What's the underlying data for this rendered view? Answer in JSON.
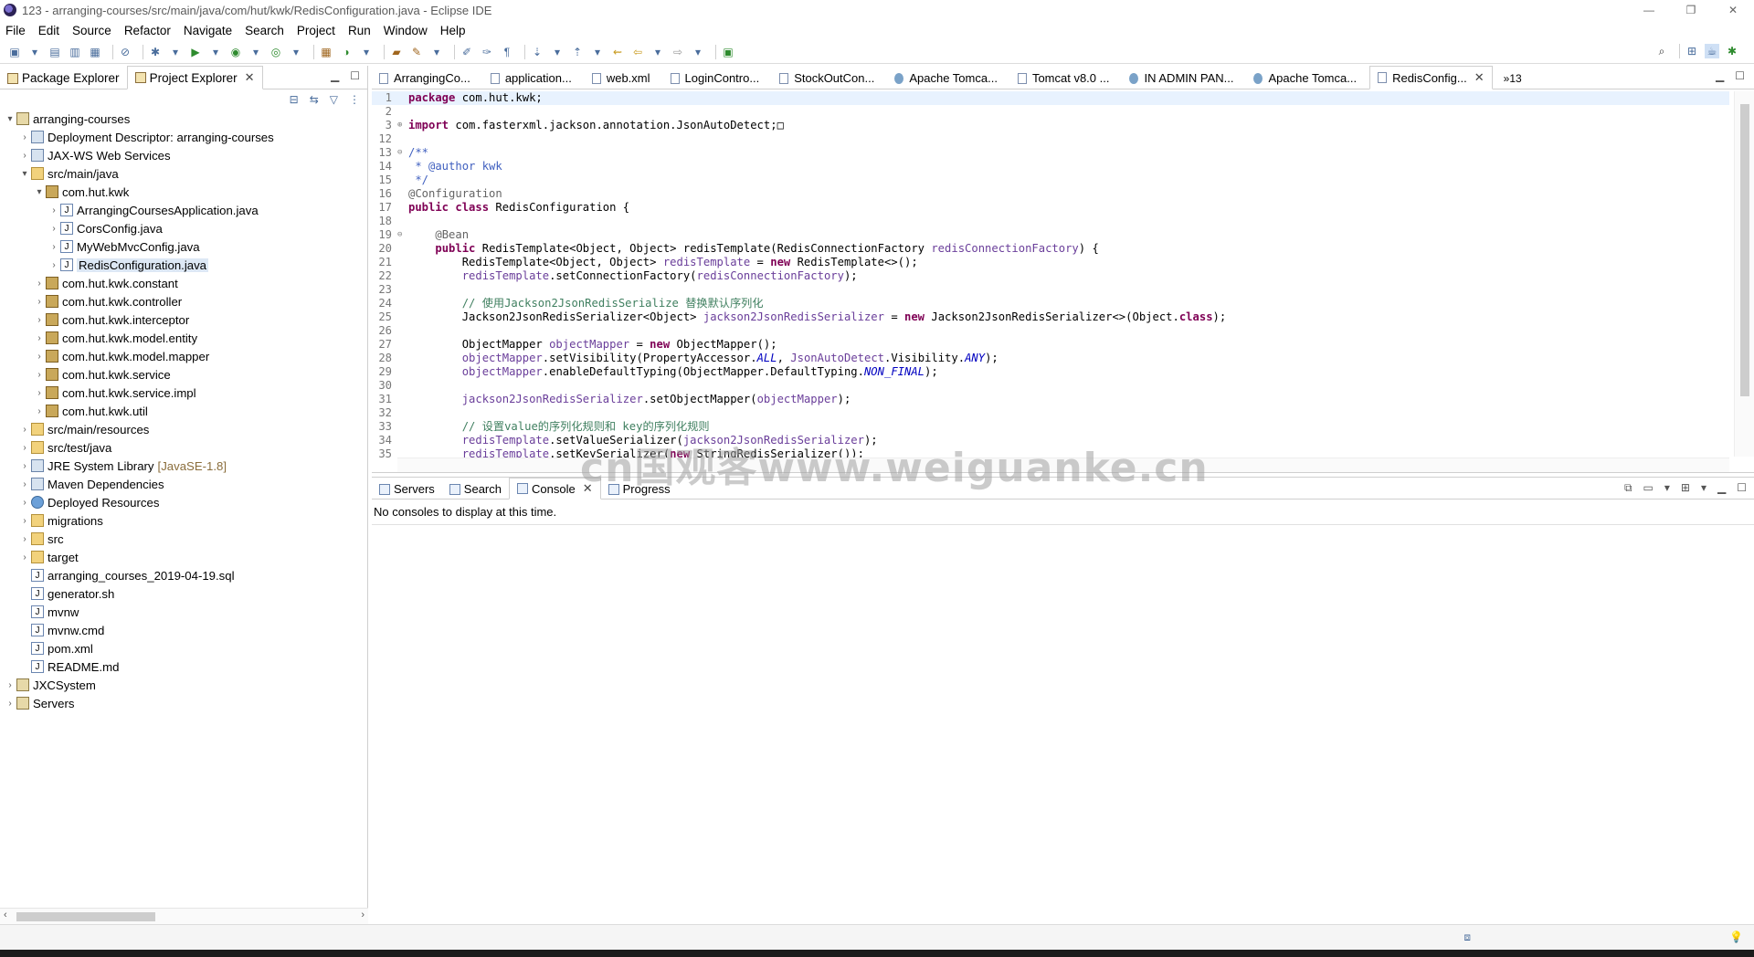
{
  "window": {
    "title": "123 - arranging-courses/src/main/java/com/hut/kwk/RedisConfiguration.java - Eclipse IDE",
    "minimize": "—",
    "restore": "❐",
    "close": "✕"
  },
  "menu": [
    "File",
    "Edit",
    "Source",
    "Refactor",
    "Navigate",
    "Search",
    "Project",
    "Run",
    "Window",
    "Help"
  ],
  "left_tabs": [
    {
      "label": "Package Explorer",
      "active": false
    },
    {
      "label": "Project Explorer",
      "active": true
    }
  ],
  "tree": [
    {
      "label": "arranging-courses",
      "depth": 0,
      "twisty": "v",
      "icon": "proj"
    },
    {
      "label": "Deployment Descriptor: arranging-courses",
      "depth": 1,
      "twisty": ">",
      "icon": "lib"
    },
    {
      "label": "JAX-WS Web Services",
      "depth": 1,
      "twisty": ">",
      "icon": "lib"
    },
    {
      "label": "src/main/java",
      "depth": 1,
      "twisty": "v",
      "icon": "folder"
    },
    {
      "label": "com.hut.kwk",
      "depth": 2,
      "twisty": "v",
      "icon": "pkg"
    },
    {
      "label": "ArrangingCoursesApplication.java",
      "depth": 3,
      "twisty": ">",
      "icon": "file"
    },
    {
      "label": "CorsConfig.java",
      "depth": 3,
      "twisty": ">",
      "icon": "file"
    },
    {
      "label": "MyWebMvcConfig.java",
      "depth": 3,
      "twisty": ">",
      "icon": "file"
    },
    {
      "label": "RedisConfiguration.java",
      "depth": 3,
      "twisty": ">",
      "icon": "file",
      "selected": true
    },
    {
      "label": "com.hut.kwk.constant",
      "depth": 2,
      "twisty": ">",
      "icon": "pkg"
    },
    {
      "label": "com.hut.kwk.controller",
      "depth": 2,
      "twisty": ">",
      "icon": "pkg"
    },
    {
      "label": "com.hut.kwk.interceptor",
      "depth": 2,
      "twisty": ">",
      "icon": "pkg"
    },
    {
      "label": "com.hut.kwk.model.entity",
      "depth": 2,
      "twisty": ">",
      "icon": "pkg"
    },
    {
      "label": "com.hut.kwk.model.mapper",
      "depth": 2,
      "twisty": ">",
      "icon": "pkg"
    },
    {
      "label": "com.hut.kwk.service",
      "depth": 2,
      "twisty": ">",
      "icon": "pkg"
    },
    {
      "label": "com.hut.kwk.service.impl",
      "depth": 2,
      "twisty": ">",
      "icon": "pkg"
    },
    {
      "label": "com.hut.kwk.util",
      "depth": 2,
      "twisty": ">",
      "icon": "pkg"
    },
    {
      "label": "src/main/resources",
      "depth": 1,
      "twisty": ">",
      "icon": "folder"
    },
    {
      "label": "src/test/java",
      "depth": 1,
      "twisty": ">",
      "icon": "folder"
    },
    {
      "label": "JRE System Library",
      "suffix": "[JavaSE-1.8]",
      "depth": 1,
      "twisty": ">",
      "icon": "lib"
    },
    {
      "label": "Maven Dependencies",
      "depth": 1,
      "twisty": ">",
      "icon": "lib"
    },
    {
      "label": "Deployed Resources",
      "depth": 1,
      "twisty": ">",
      "icon": "globe"
    },
    {
      "label": "migrations",
      "depth": 1,
      "twisty": ">",
      "icon": "folder"
    },
    {
      "label": "src",
      "depth": 1,
      "twisty": ">",
      "icon": "folder"
    },
    {
      "label": "target",
      "depth": 1,
      "twisty": ">",
      "icon": "folder"
    },
    {
      "label": "arranging_courses_2019-04-19.sql",
      "depth": 1,
      "twisty": "",
      "icon": "file"
    },
    {
      "label": "generator.sh",
      "depth": 1,
      "twisty": "",
      "icon": "file"
    },
    {
      "label": "mvnw",
      "depth": 1,
      "twisty": "",
      "icon": "file"
    },
    {
      "label": "mvnw.cmd",
      "depth": 1,
      "twisty": "",
      "icon": "file"
    },
    {
      "label": "pom.xml",
      "depth": 1,
      "twisty": "",
      "icon": "file"
    },
    {
      "label": "README.md",
      "depth": 1,
      "twisty": "",
      "icon": "file"
    },
    {
      "label": "JXCSystem",
      "depth": 0,
      "twisty": ">",
      "icon": "proj"
    },
    {
      "label": "Servers",
      "depth": 0,
      "twisty": ">",
      "icon": "proj"
    }
  ],
  "editor_tabs": [
    {
      "label": "ArrangingCo...",
      "icon": "file"
    },
    {
      "label": "application...",
      "icon": "file"
    },
    {
      "label": "web.xml",
      "icon": "file"
    },
    {
      "label": "LoginContro...",
      "icon": "file"
    },
    {
      "label": "StockOutCon...",
      "icon": "file"
    },
    {
      "label": "Apache Tomca...",
      "icon": "globe"
    },
    {
      "label": "Tomcat v8.0 ...",
      "icon": "file"
    },
    {
      "label": "IN ADMIN PAN...",
      "icon": "globe"
    },
    {
      "label": "Apache Tomca...",
      "icon": "globe"
    },
    {
      "label": "RedisConfig...",
      "icon": "file",
      "active": true
    }
  ],
  "editor_more": "»13",
  "code_lines": [
    {
      "n": "1",
      "html": "<span class='kw'>package</span> com.hut.kwk;",
      "cur": true
    },
    {
      "n": "2",
      "html": ""
    },
    {
      "n": "3",
      "fold": "⊕",
      "html": "<span class='kw'>import</span> com.fasterxml.jackson.annotation.JsonAutoDetect;□"
    },
    {
      "n": "12",
      "html": ""
    },
    {
      "n": "13",
      "fold": "⊖",
      "html": "<span class='doc'>/**</span>"
    },
    {
      "n": "14",
      "html": "<span class='doc'> * @author kwk</span>"
    },
    {
      "n": "15",
      "html": "<span class='doc'> */</span>"
    },
    {
      "n": "16",
      "html": "<span class='ann'>@Configuration</span>"
    },
    {
      "n": "17",
      "html": "<span class='kw'>public class</span> RedisConfiguration {"
    },
    {
      "n": "18",
      "html": ""
    },
    {
      "n": "19",
      "fold": "⊖",
      "html": "    <span class='ann'>@Bean</span>"
    },
    {
      "n": "20",
      "html": "    <span class='kw'>public</span> RedisTemplate&lt;Object, Object&gt; redisTemplate(RedisConnectionFactory <span class='var'>redisConnectionFactory</span>) {"
    },
    {
      "n": "21",
      "html": "        RedisTemplate&lt;Object, Object&gt; <span class='var'>redisTemplate</span> = <span class='kw'>new</span> RedisTemplate&lt;&gt;();"
    },
    {
      "n": "22",
      "html": "        <span class='var'>redisTemplate</span>.setConnectionFactory(<span class='var'>redisConnectionFactory</span>);"
    },
    {
      "n": "23",
      "html": ""
    },
    {
      "n": "24",
      "html": "        <span class='cmt'>// 使用Jackson2JsonRedisSerialize 替换默认序列化</span>"
    },
    {
      "n": "25",
      "html": "        Jackson2JsonRedisSerializer&lt;Object&gt; <span class='var'>jackson2JsonRedisSerializer</span> = <span class='kw'>new</span> Jackson2JsonRedisSerializer&lt;&gt;(Object.<span class='kw'>class</span>);"
    },
    {
      "n": "26",
      "html": ""
    },
    {
      "n": "27",
      "html": "        ObjectMapper <span class='var'>objectMapper</span> = <span class='kw'>new</span> ObjectMapper();"
    },
    {
      "n": "28",
      "html": "        <span class='var'>objectMapper</span>.setVisibility(PropertyAccessor.<span class='static'>ALL</span>, <span class='var'>JsonAutoDetect</span>.Visibility.<span class='static'>ANY</span>);"
    },
    {
      "n": "29",
      "html": "        <span class='var'>objectMapper</span>.enableDefaultTyping(ObjectMapper.DefaultTyping.<span class='static'>NON_FINAL</span>);"
    },
    {
      "n": "30",
      "html": ""
    },
    {
      "n": "31",
      "html": "        <span class='var'>jackson2JsonRedisSerializer</span>.setObjectMapper(<span class='var'>objectMapper</span>);"
    },
    {
      "n": "32",
      "html": ""
    },
    {
      "n": "33",
      "html": "        <span class='cmt'>// 设置value的序列化规则和 key的序列化规则</span>"
    },
    {
      "n": "34",
      "html": "        <span class='var'>redisTemplate</span>.setValueSerializer(<span class='var'>jackson2JsonRedisSerializer</span>);"
    },
    {
      "n": "35",
      "html": "        <span class='var'>redisTemplate</span>.setKeySerializer(<span class='kw'>new</span> StringRedisSerializer());"
    }
  ],
  "bottom_tabs": [
    {
      "label": "Servers",
      "active": false
    },
    {
      "label": "Search",
      "active": false
    },
    {
      "label": "Console",
      "active": true
    },
    {
      "label": "Progress",
      "active": false
    }
  ],
  "console": {
    "message": "No consoles to display at this time."
  },
  "watermark": "cn国观客www.weiguanke.cn"
}
